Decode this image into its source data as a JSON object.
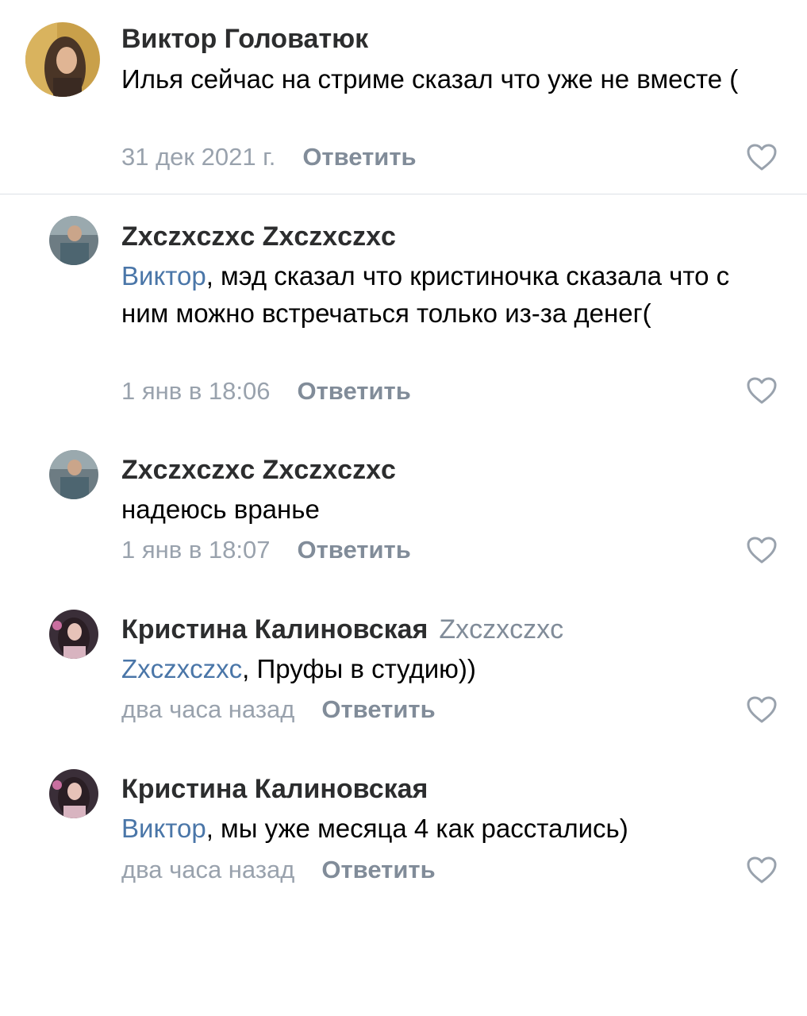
{
  "comments": [
    {
      "author": "Виктор Головатюк",
      "reply_to": "",
      "mention": "",
      "text": "Илья сейчас на стриме сказал что уже не вместе (",
      "date": "31 дек 2021 г.",
      "reply_label": "Ответить",
      "like_icon": "heart-outline-icon"
    },
    {
      "author": "Zxczxczxc Zxczxczxc",
      "reply_to": "",
      "mention": "Виктор",
      "text": ", мэд сказал что кристиночка сказала что с ним можно встречаться только из-за денег(",
      "date": "1 янв в 18:06",
      "reply_label": "Ответить",
      "like_icon": "heart-outline-icon"
    },
    {
      "author": "Zxczxczxc Zxczxczxc",
      "reply_to": "",
      "mention": "",
      "text": "надеюсь вранье",
      "date": "1 янв в 18:07",
      "reply_label": "Ответить",
      "like_icon": "heart-outline-icon"
    },
    {
      "author": "Кристина Калиновская",
      "reply_to": "Zxczxczxc",
      "mention": "Zxczxczxc",
      "text": ", Пруфы в студию))",
      "date": "два часа назад",
      "reply_label": "Ответить",
      "like_icon": "heart-outline-icon"
    },
    {
      "author": "Кристина Калиновская",
      "reply_to": "",
      "mention": "Виктор",
      "text": ", мы уже месяца 4 как расстались)",
      "date": "два часа назад",
      "reply_label": "Ответить",
      "like_icon": "heart-outline-icon"
    }
  ],
  "colors": {
    "name": "#2c2d2e",
    "mention": "#4a76a8",
    "meta": "#99a2ad",
    "reply": "#818c99",
    "divider": "#dce1e6"
  }
}
